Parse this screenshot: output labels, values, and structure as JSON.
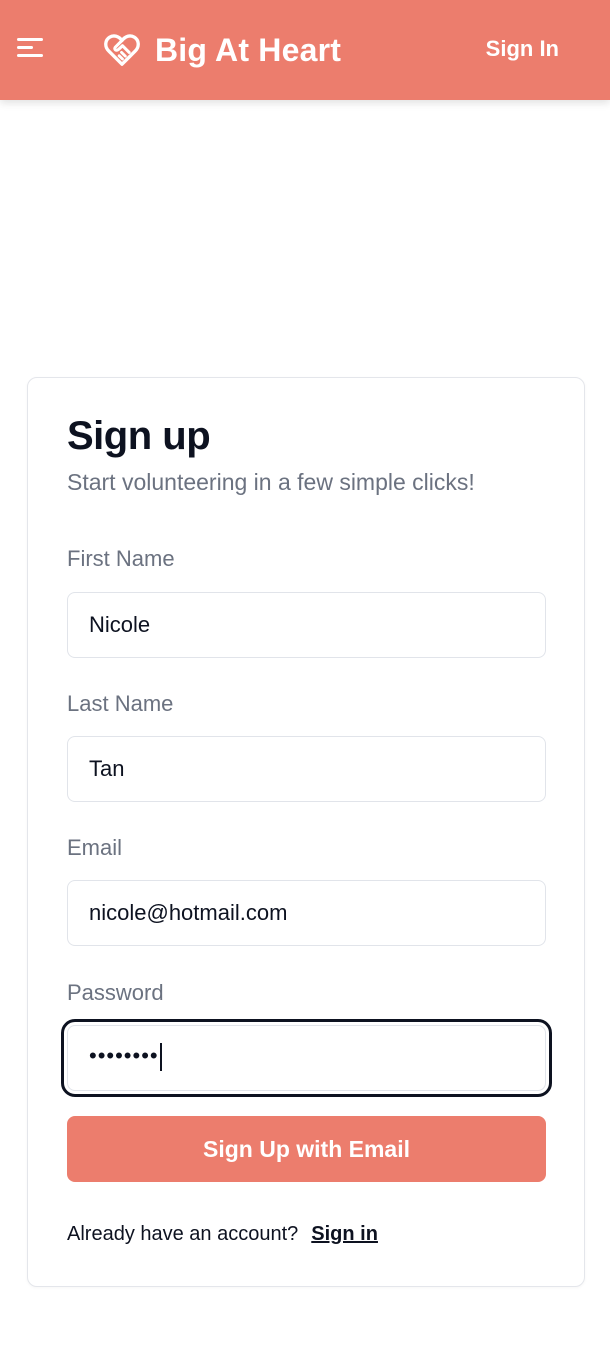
{
  "header": {
    "brand_title": "Big At Heart",
    "signin_label": "Sign In",
    "icons": {
      "menu": "hamburger-menu-icon",
      "brand": "heart-handshake-icon"
    },
    "colors": {
      "brand_coral": "#ec7d6d",
      "text_dark": "#0d1220",
      "text_muted": "#6b7280"
    }
  },
  "form": {
    "title": "Sign up",
    "subtitle": "Start volunteering in a few simple clicks!",
    "fields": {
      "first_name": {
        "label": "First Name",
        "value": "Nicole"
      },
      "last_name": {
        "label": "Last Name",
        "value": "Tan"
      },
      "email": {
        "label": "Email",
        "value": "nicole@hotmail.com"
      },
      "password": {
        "label": "Password",
        "masked_value": "••••••••"
      }
    },
    "submit_label": "Sign Up with Email",
    "footer": {
      "prompt": "Already have an account?",
      "link": "Sign in"
    }
  }
}
